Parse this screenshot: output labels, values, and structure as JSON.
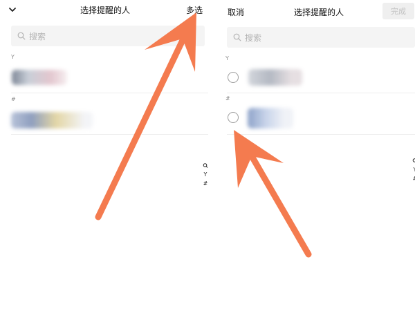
{
  "left": {
    "title": "选择提醒的人",
    "multi_select_label": "多选",
    "search_placeholder": "搜索",
    "sections": [
      {
        "letter": "Y"
      },
      {
        "letter": "#"
      }
    ],
    "index_letters": [
      "Y",
      "#"
    ]
  },
  "right": {
    "title": "选择提醒的人",
    "cancel_label": "取消",
    "done_label": "完成",
    "search_placeholder": "搜索",
    "sections": [
      {
        "letter": "Y"
      },
      {
        "letter": "#"
      }
    ],
    "index_letters": [
      "Y",
      "#"
    ]
  },
  "colors": {
    "annotation_arrow": "#F47B4F",
    "done_disabled_bg": "#EFEFEF",
    "search_bg": "#F4F4F4"
  },
  "icons": [
    "chevron-down-icon",
    "search-icon",
    "radio-unchecked-icon",
    "arrow-annotation"
  ]
}
